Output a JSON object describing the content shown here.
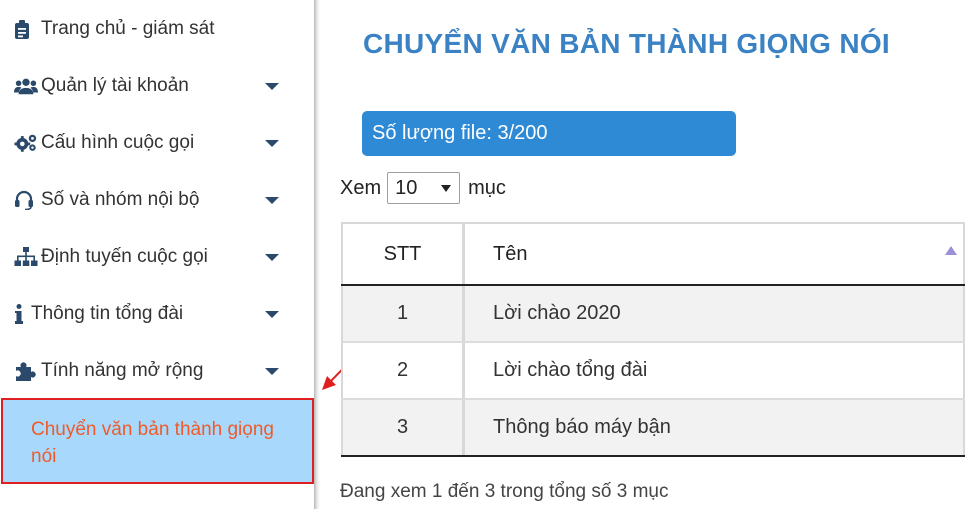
{
  "sidebar": {
    "items": [
      {
        "label": "Trang chủ - giám sát",
        "icon": "clipboard-icon",
        "has_caret": false
      },
      {
        "label": "Quản lý tài khoản",
        "icon": "users-icon",
        "has_caret": true
      },
      {
        "label": "Cấu hình cuộc gọi",
        "icon": "gears-icon",
        "has_caret": true
      },
      {
        "label": "Số và nhóm nội bộ",
        "icon": "headset-icon",
        "has_caret": true
      },
      {
        "label": "Định tuyến cuộc gọi",
        "icon": "sitemap-icon",
        "has_caret": true
      },
      {
        "label": "Thông tin tổng đài",
        "icon": "info-icon",
        "has_caret": true
      },
      {
        "label": "Tính năng mở rộng",
        "icon": "puzzle-icon",
        "has_caret": true
      }
    ],
    "active_item": {
      "label": "Chuyển văn bản thành giọng nói"
    },
    "colors": {
      "active_bg": "#a8d8fb",
      "active_text": "#f05a28",
      "highlight_border": "#e02020"
    }
  },
  "main": {
    "title": "CHUYỂN VĂN BẢN THÀNH GIỌNG NÓI",
    "file_count": {
      "label": "Số lượng file:",
      "value": "3/200"
    },
    "length": {
      "prefix": "Xem",
      "selected": "10",
      "suffix": "mục"
    },
    "table": {
      "columns": [
        "STT",
        "Tên"
      ],
      "sort": {
        "column": "Tên",
        "direction": "asc"
      },
      "rows": [
        {
          "stt": "1",
          "name": "Lời chào 2020"
        },
        {
          "stt": "2",
          "name": "Lời chào tổng đài"
        },
        {
          "stt": "3",
          "name": "Thông báo máy bận"
        }
      ]
    },
    "info": "Đang xem 1 đến 3 trong tổng số 3 mục",
    "colors": {
      "title": "#3b82c4",
      "badge_bg": "#2f8ad5"
    }
  },
  "annotation": {
    "arrow_color": "#e02020"
  }
}
